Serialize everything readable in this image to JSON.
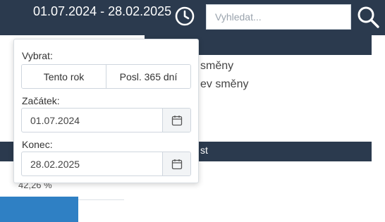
{
  "header": {
    "date_range": "01.07.2024 - 28.02.2025",
    "clock_icon": "clock-icon",
    "search_placeholder": "Vyhledat...",
    "search_icon": "search-icon"
  },
  "background": {
    "line1": "směny",
    "line2": "ev směny",
    "bar_label": "st",
    "percent": "42,26 %"
  },
  "popover": {
    "select_label": "Vybrat:",
    "presets": [
      "Tento rok",
      "Posl. 365 dní"
    ],
    "start_label": "Začátek:",
    "start_value": "01.07.2024",
    "end_label": "Konec:",
    "end_value": "28.02.2025",
    "calendar_icon": "calendar-icon"
  },
  "colors": {
    "header_bg": "#2b3a4e",
    "accent_blue": "#2f80c4"
  }
}
